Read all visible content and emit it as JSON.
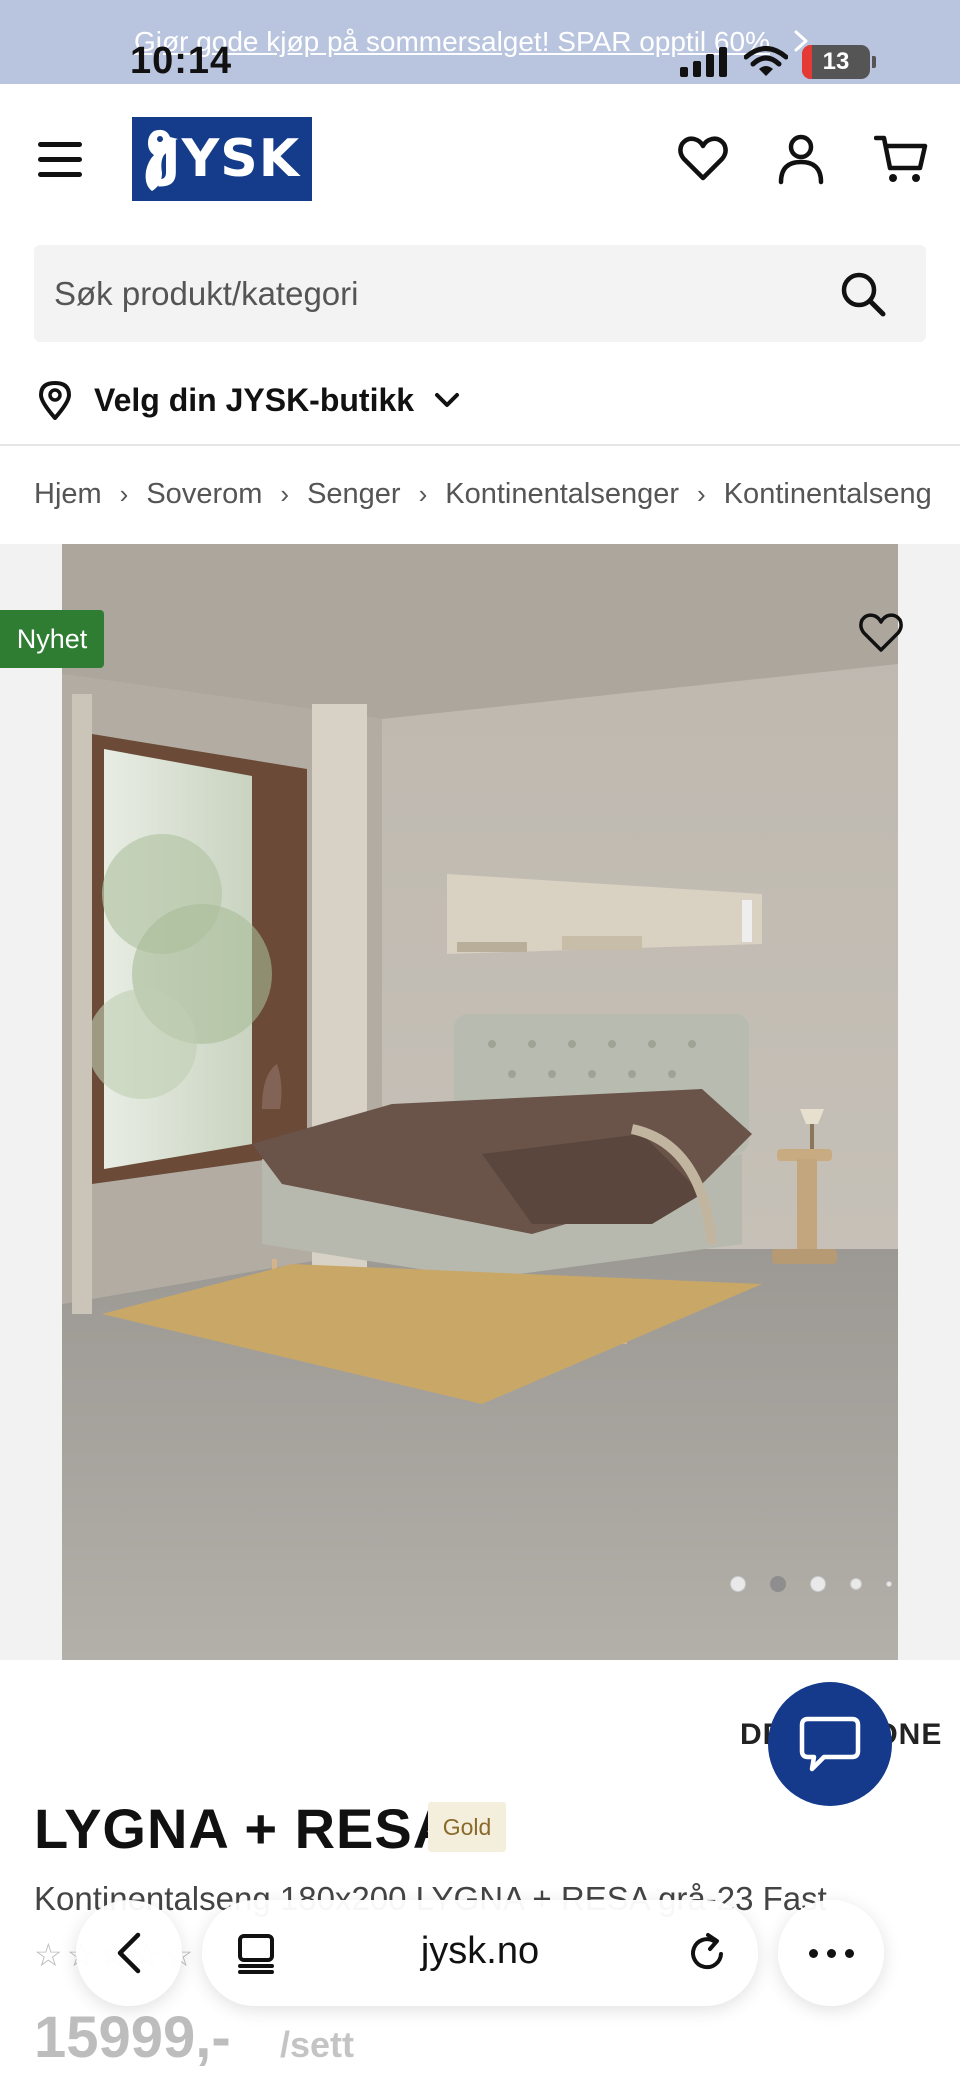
{
  "promo": {
    "text": "Gjør gode kjøp på sommersalget! SPAR opptil 60%"
  },
  "status_bar": {
    "time": "10:14",
    "battery": "13"
  },
  "header": {
    "logo_text": "JYSK",
    "brand_color": "#143c8a",
    "icons": [
      "menu-icon",
      "heart-icon",
      "user-icon",
      "cart-icon"
    ]
  },
  "search": {
    "placeholder": "Søk produkt/kategori"
  },
  "store": {
    "label": "Velg din JYSK-butikk"
  },
  "breadcrumb": [
    "Hjem",
    "Soverom",
    "Senger",
    "Kontinentalsenger",
    "Kontinentalseng"
  ],
  "gallery": {
    "badge": "Nyhet",
    "badge_color": "#2e7d32",
    "slides": 5,
    "active_slide": 2
  },
  "product": {
    "brand": "DREAMZONE",
    "title": "LYGNA + RESA",
    "tier": "Gold",
    "subtitle": "Kontinentalseng 180x200 LYGNA + RESA grå-23 Fast",
    "rating": 0,
    "price": "15999,-",
    "unit": "/sett"
  },
  "browser": {
    "url": "jysk.no"
  },
  "chat": {
    "color": "#153a8c"
  }
}
